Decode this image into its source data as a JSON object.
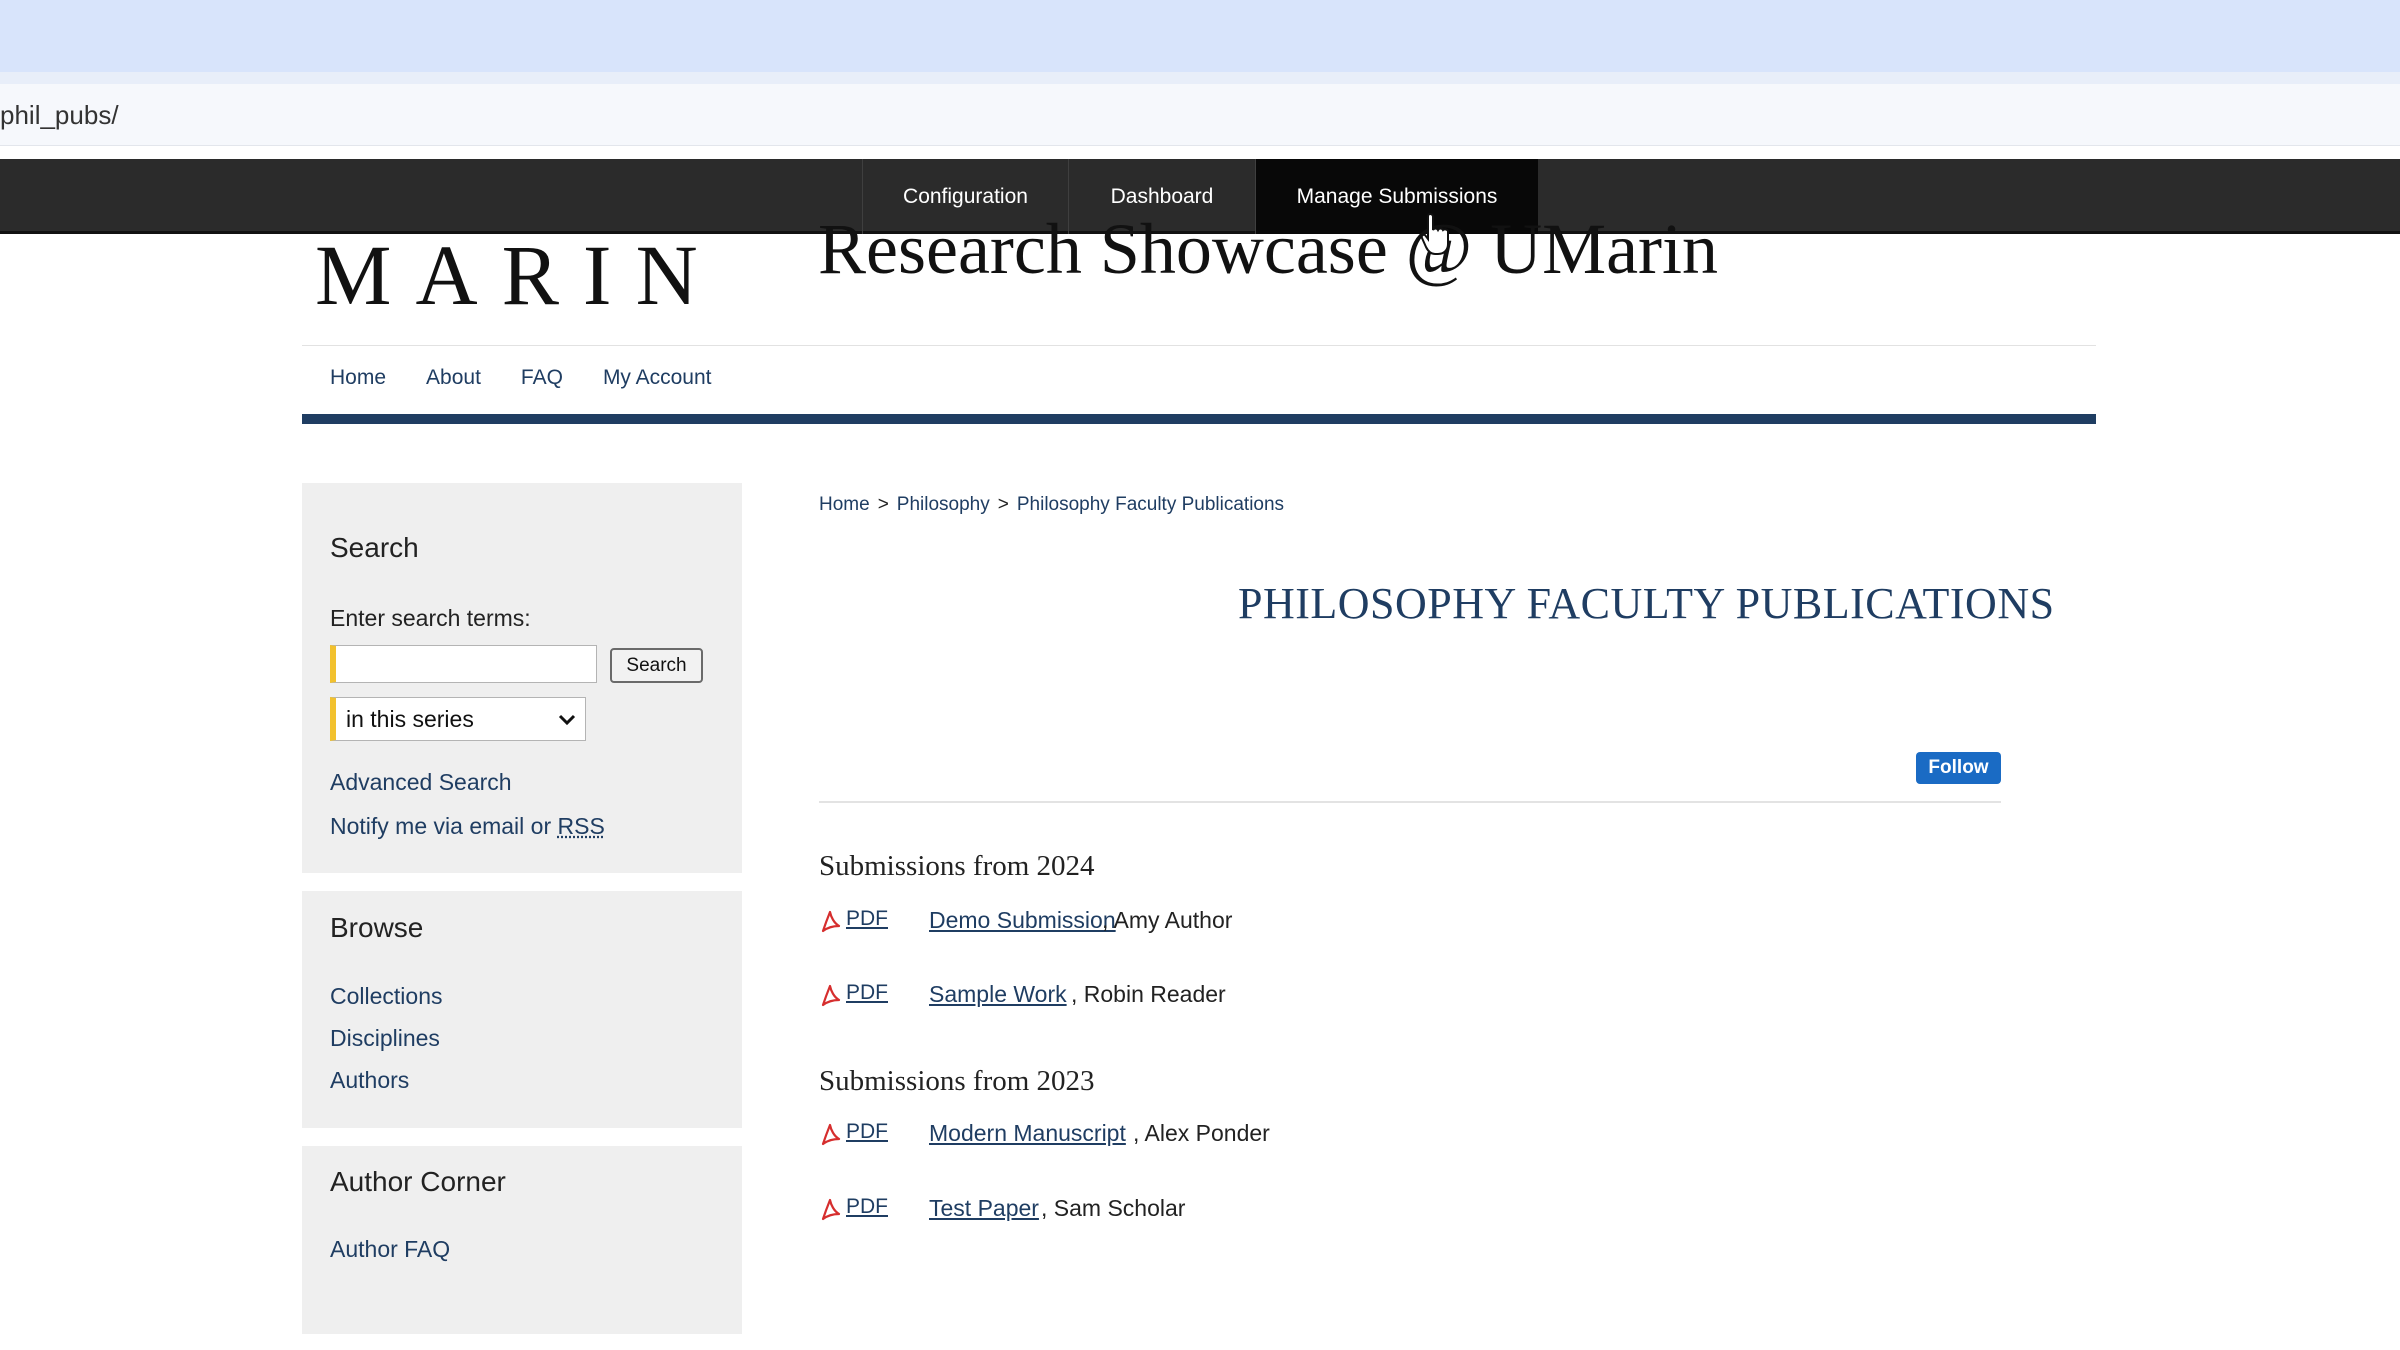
{
  "browser": {
    "url": "phil_pubs/"
  },
  "admin_bar": {
    "items": [
      {
        "label": "Configuration"
      },
      {
        "label": "Dashboard"
      },
      {
        "label": "Manage Submissions",
        "active": true
      }
    ]
  },
  "header": {
    "logo": "MARIN",
    "site_title": "Research Showcase @ UMarin"
  },
  "main_nav": {
    "items": [
      "Home",
      "About",
      "FAQ",
      "My Account"
    ]
  },
  "sidebar": {
    "search": {
      "title": "Search",
      "prompt": "Enter search terms:",
      "input_value": "",
      "button_label": "Search",
      "scope_selected": "in this series",
      "advanced_link": "Advanced Search",
      "notify_text": "Notify me via email or ",
      "rss_link": "RSS"
    },
    "browse": {
      "title": "Browse",
      "links": [
        "Collections",
        "Disciplines",
        "Authors"
      ]
    },
    "author_corner": {
      "title": "Author Corner",
      "links": [
        "Author FAQ"
      ]
    }
  },
  "content": {
    "breadcrumb": [
      "Home",
      "Philosophy",
      "Philosophy Faculty Publications"
    ],
    "breadcrumb_sep": ">",
    "page_title": "PHILOSOPHY FACULTY PUBLICATIONS",
    "follow_label": "Follow",
    "groups": [
      {
        "heading": "Submissions from 2024",
        "items": [
          {
            "pdf": "PDF",
            "title": "Demo Submission",
            "author": ", Amy Author"
          },
          {
            "pdf": "PDF",
            "title": "Sample Work",
            "author": ", Robin Reader"
          }
        ]
      },
      {
        "heading": "Submissions from 2023",
        "items": [
          {
            "pdf": "PDF",
            "title": "Modern Manuscript",
            "author": ", Alex Ponder"
          },
          {
            "pdf": "PDF",
            "title": "Test Paper",
            "author": ", Sam Scholar"
          }
        ]
      }
    ]
  },
  "colors": {
    "brand_navy": "#1f3d62",
    "admin_bar": "#2b2b2b",
    "accent_yellow": "#f2c12e",
    "follow_blue": "#1a6bc4",
    "pdf_red": "#d62e2e"
  }
}
